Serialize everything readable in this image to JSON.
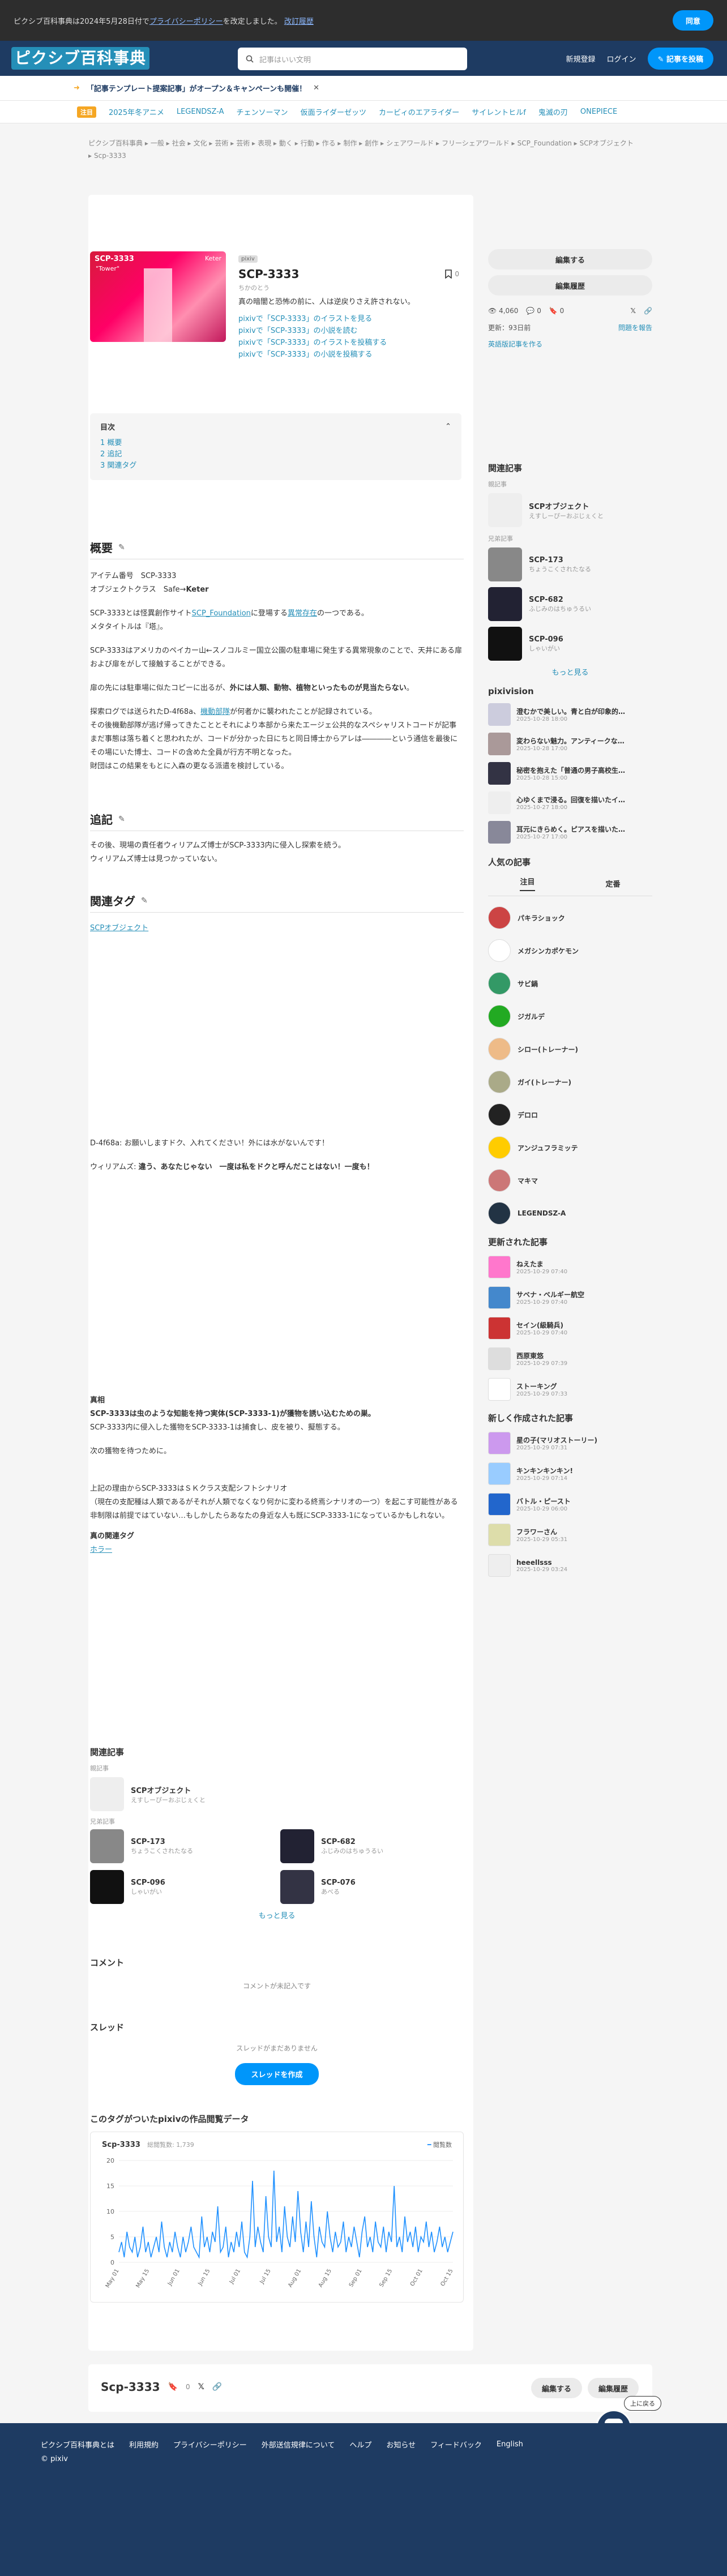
{
  "notice": {
    "text": "ピクシブ百科事典は2024年5月28日付で",
    "link": "プライバシーポリシー",
    "text2": "を改定しました。",
    "link2": "改訂履歴",
    "agree": "同意"
  },
  "header": {
    "logo": "ピクシブ百科事典",
    "search_placeholder": "記事はいい文明",
    "register": "新規登録",
    "login": "ログイン",
    "post": "記事を投稿"
  },
  "promo": {
    "text": "「記事テンプレート提案記事」がオープン＆キャンペーンも開催！"
  },
  "trend": {
    "label": "注目",
    "items": [
      "2025年冬アニメ",
      "LEGENDSZ-A",
      "チェンソーマン",
      "仮面ライダーゼッツ",
      "カービィのエアライダー",
      "サイレントヒルf",
      "鬼滅の刃",
      "ONEPIECE"
    ]
  },
  "breadcrumbs": [
    "ピクシブ百科事典",
    "一般",
    "社会",
    "文化",
    "芸術",
    "芸術",
    "表現",
    "動く",
    "行動",
    "作る",
    "制作",
    "創作",
    "シェアワールド",
    "フリーシェアワールド",
    "SCP_Foundation",
    "SCPオブジェクト",
    "Scp-3333"
  ],
  "article": {
    "tag": "pixiv",
    "title": "SCP-3333",
    "reading": "ちかのとう",
    "summary": "真の暗闇と恐怖の前に、人は逆戻りさえ許されない。",
    "bookmarks": "0",
    "cover_text": "SCP-3333",
    "cover_sub": "\"Tower\"",
    "cover_brand": "Keter",
    "links": [
      "pixivで「SCP-3333」のイラストを見る",
      "pixivで「SCP-3333」の小説を読む",
      "pixivで「SCP-3333」のイラストを投稿する",
      "pixivで「SCP-3333」の小説を投稿する"
    ],
    "toc_title": "目次",
    "toc": [
      "1 概要",
      "2 追記",
      "3 関連タグ"
    ],
    "overview_h": "概要",
    "item_no": "アイテム番号　SCP-3333",
    "object_class": "オブジェクトクラス　Safe→",
    "object_class_val": "Keter",
    "p1a": "SCP-3333とは怪異創作サイト",
    "p1link": "SCP_Foundation",
    "p1b": "に登場する",
    "p1link2": "異常存在",
    "p1c": "の一つである。",
    "p1d": "メタタイトルは『塔』。",
    "p2": "SCP-3333はアメリカのペイカー山←スノコルミー国立公園の駐車場に発生する異常現象のことで、天井にある扉および扉をがして接触することができる。",
    "p3a": "扉の先には駐車場に似たコピーに出るが、",
    "p3b": "外には人類、動物、植物といったものが見当たらない",
    "p3c": "。",
    "p4a": "探索ログでは送られたD-4f68a、",
    "p4link": "機動部隊",
    "p4b": "が何者かに襲われたことが記録されている。",
    "p5": "その後機動部隊が逃げ帰ってきたこととそれにより本部から来たエージェ公共的なスペシャリストコードが記事まだ事態は落ち着くと思われたが、コードが分かった日にちと同日博士からアレは――――という通信を最後にその場にいた博士、コードの含めた全員が行方不明となった。",
    "p6": "財団はこの結果をもとに入森の更なる派遣を検討している。",
    "addendum_h": "追記",
    "add1": "その後、現場の責任者ウィリアムズ博士がSCP-3333内に侵入し探索を続う。",
    "add2": "ウィリアムズ博士は見つかっていない。",
    "related_h": "関連タグ",
    "related_tag": "SCPオブジェクト",
    "dlg1": "D-4f68a: お願いしますドク、入れてください！外には水がないんです！",
    "dlg2a": "ウィリアムズ: ",
    "dlg2b": "違う、あなたじゃない　一度は私をドクと呼んだことはない！一度も！",
    "end_h": "真相",
    "end1": "SCP-3333は虫のような知能を持つ実体(SCP-3333-1)が獲物を誘い込むための巣。",
    "end2": "SCP-3333内に侵入した獲物をSCP-3333-1は捕食し、皮を被り、擬態する。",
    "end3": "次の獲物を待つために。",
    "end4": "上記の理由からSCP-3333はＳＫクラス支配シフトシナリオ",
    "end5": "（現在の支配種は人類であるがそれが人類でなくなり何かに変わる終焉シナリオの一つ）を起こす可能性がある非制限は前提ではていない…もしかしたらあなたの身近な人も既にSCP-3333-1になっているかもしれない。",
    "end_tag_h": "真の関連タグ",
    "end_tag": "ホラー"
  },
  "related_articles": {
    "title": "関連記事",
    "parent_h": "親記事",
    "parent": {
      "name": "SCPオブジェクト",
      "sub": "えすしーぴーおぶじぇくと"
    },
    "siblings_h": "兄弟記事",
    "siblings": [
      {
        "name": "SCP-173",
        "sub": "ちょうこくされたなる"
      },
      {
        "name": "SCP-682",
        "sub": "ふじみのはちゅうるい"
      },
      {
        "name": "SCP-096",
        "sub": "しゃいがい"
      },
      {
        "name": "SCP-076",
        "sub": "あべる"
      }
    ],
    "more": "もっと見る"
  },
  "comments": {
    "title": "コメント",
    "empty": "コメントが未記入です"
  },
  "threads": {
    "title": "スレッド",
    "empty": "スレッドがまだありません",
    "create": "スレッドを作成"
  },
  "chart_section": {
    "title": "このタグがついたpixivの作品閲覧データ"
  },
  "chart_data": {
    "type": "line",
    "title": "Scp-3333",
    "subtitle": "総閲覧数: 1,739",
    "legend": "閲覧数",
    "ylim": [
      0,
      20
    ],
    "yticks": [
      0,
      5,
      10,
      15,
      20
    ],
    "xticks": [
      "May 01",
      "May 15",
      "Jun 01",
      "Jun 15",
      "Jul 01",
      "Jul 15",
      "Aug 01",
      "Aug 15",
      "Sep 01",
      "Sep 15",
      "Oct 01",
      "Oct 15"
    ],
    "values": [
      2,
      4,
      1,
      6,
      3,
      2,
      5,
      1,
      3,
      7,
      2,
      4,
      1,
      3,
      5,
      2,
      8,
      3,
      1,
      4,
      2,
      6,
      3,
      1,
      5,
      2,
      4,
      7,
      3,
      2,
      1,
      9,
      3,
      5,
      2,
      6,
      4,
      11,
      2,
      3,
      7,
      1,
      4,
      2,
      6,
      3,
      8,
      2,
      1,
      5,
      16,
      3,
      7,
      4,
      2,
      13,
      5,
      3,
      18,
      4,
      7,
      2,
      11,
      5,
      3,
      9,
      4,
      14,
      6,
      2,
      8,
      3,
      12,
      5,
      1,
      7,
      4,
      3,
      10,
      5,
      2,
      6,
      3,
      4,
      8,
      2,
      5,
      3,
      7,
      4,
      1,
      6,
      9,
      3,
      5,
      2,
      8,
      4,
      3,
      7,
      2,
      6,
      4,
      15,
      3,
      5,
      2,
      9,
      4,
      6,
      3,
      7,
      2,
      5,
      4,
      8,
      3,
      6,
      2,
      4,
      7,
      3,
      5,
      2,
      4,
      6
    ]
  },
  "footbar": {
    "title": "Scp-3333",
    "bm": "0",
    "edit": "編集する",
    "history": "編集履歴",
    "back": "上に戻る"
  },
  "sidebar": {
    "edit": "編集する",
    "history": "編集履歴",
    "views": "4,060",
    "comments": "0",
    "bookmarks": "0",
    "updated": "更新：93日前",
    "report": "問題を報告",
    "child_create": "英語版記事を作る",
    "rel_title": "関連記事",
    "parent_h": "親記事",
    "parent": {
      "name": "SCPオブジェクト",
      "sub": "えすしーぴーおぶじぇくと"
    },
    "sib_h": "兄弟記事",
    "siblings": [
      {
        "name": "SCP-173",
        "sub": "ちょうこくされたなる"
      },
      {
        "name": "SCP-682",
        "sub": "ふじみのはちゅうるい"
      },
      {
        "name": "SCP-096",
        "sub": "しゃいがい"
      }
    ],
    "more": "もっと見る",
    "pixivision_h": "pixivision",
    "pixivision": [
      {
        "t": "澄むかで美しい。青と白が印象的…",
        "d": "2025-10-28 18:00"
      },
      {
        "t": "変わらない魅力。アンティークな…",
        "d": "2025-10-28 17:00"
      },
      {
        "t": "秘密を抱えた「普通の男子高校生…",
        "d": "2025-10-28 15:00"
      },
      {
        "t": "心ゆくまで浸る。回復を描いたイ…",
        "d": "2025-10-27 18:00"
      },
      {
        "t": "耳元にきらめく。ピアスを描いた…",
        "d": "2025-10-27 17:00"
      }
    ],
    "popular_h": "人気の記事",
    "tabs": [
      "注目",
      "定番"
    ],
    "popular": [
      "パキラショック",
      "メガシンカポケモン",
      "サビ鍋",
      "ジガルデ",
      "シロー(トレーナー)",
      "ガイ(トレーナー)",
      "デロロ",
      "アンジュフラミッテ",
      "マキマ",
      "LEGENDSZ-A"
    ],
    "updated_h": "更新された記事",
    "updated_list": [
      {
        "t": "ねえたま",
        "d": "2025-10-29 07:40"
      },
      {
        "t": "サベナ・ベルギー航空",
        "d": "2025-10-29 07:40"
      },
      {
        "t": "セイン(級騎兵)",
        "d": "2025-10-29 07:40"
      },
      {
        "t": "西原東悠",
        "d": "2025-10-29 07:39"
      },
      {
        "t": "ストーキング",
        "d": "2025-10-29 07:33"
      }
    ],
    "new_h": "新しく作成された記事",
    "new_list": [
      {
        "t": "星の子(マリオストーリー)",
        "d": "2025-10-29 07:31"
      },
      {
        "t": "キンキンキンキン!",
        "d": "2025-10-29 07:14"
      },
      {
        "t": "バトル・ピースト",
        "d": "2025-10-29 06:00"
      },
      {
        "t": "フラワーさん",
        "d": "2025-10-29 05:31"
      },
      {
        "t": "heeellsss",
        "d": "2025-10-29 03:24"
      }
    ]
  },
  "footer": {
    "links": [
      "ピクシブ百科事典とは",
      "利用規約",
      "プライバシーポリシー",
      "外部送信規律について",
      "ヘルプ",
      "お知らせ",
      "フィードバック",
      "English"
    ],
    "copy": "© pixiv"
  }
}
